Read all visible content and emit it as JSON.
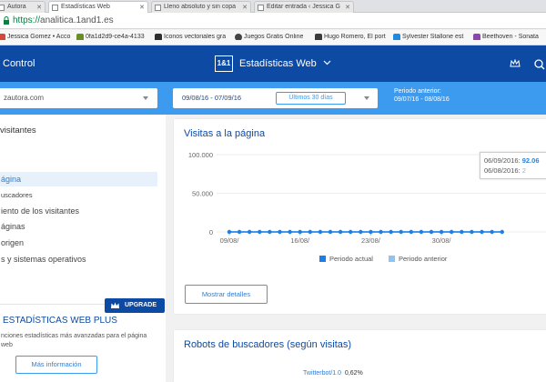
{
  "browser": {
    "tabs": [
      {
        "label": "Autora",
        "active": false
      },
      {
        "label": "Estadísticas Web",
        "active": true
      },
      {
        "label": "Lleno absoluto y sin copa",
        "active": false
      },
      {
        "label": "Editar entrada ‹ Jessica G",
        "active": false
      }
    ],
    "url_protocol": "https://",
    "url_host": "analitica.1and1.es",
    "bookmarks": [
      {
        "label": "Jessica Gomez • Acco",
        "color": "#d34836"
      },
      {
        "label": "0fa1d2d9-ce4a-4133",
        "color": "#6b8e23"
      },
      {
        "label": "Iconos vectoriales gra",
        "color": "#2f2f2f"
      },
      {
        "label": "Juegos Gratis Online",
        "color": "#444444"
      },
      {
        "label": "Hugo Romero, El port",
        "color": "#3b3b3b"
      },
      {
        "label": "Sylvester Stallone est",
        "color": "#1e88e5"
      },
      {
        "label": "Beethoven - Sonata",
        "color": "#8e44ad"
      }
    ]
  },
  "header": {
    "left_label": "Control",
    "logo_text": "1&1",
    "title": "Estadísticas Web"
  },
  "filters": {
    "domain": "zautora.com",
    "date_range": "09/08/16 - 07/09/16",
    "preset": "Últimos 30 días",
    "previous_label": "Periodo anterior:",
    "previous_range": "09/07/16 - 08/08/16"
  },
  "sidebar": {
    "heading": "visitantes",
    "items": [
      {
        "label": "ágina",
        "active": true,
        "small": false
      },
      {
        "label": "uscadores",
        "active": false,
        "small": true
      },
      {
        "label": "iento de los visitantes",
        "active": false,
        "small": false
      },
      {
        "label": "áginas",
        "active": false,
        "small": false
      },
      {
        "label": "origen",
        "active": false,
        "small": false
      },
      {
        "label": "s y sistemas operativos",
        "active": false,
        "small": false
      }
    ]
  },
  "upgrade": {
    "badge": "UPGRADE",
    "title": "ESTADÍSTICAS WEB PLUS",
    "description": "nciones estadísticas más avanzadas para el página web",
    "button": "Más información"
  },
  "visits_card": {
    "title": "Visitas a la página",
    "details_button": "Mostrar detalles",
    "tooltip": {
      "line1_date": "06/09/2016:",
      "line1_value": "92.06",
      "line2_date": "06/08/2016:",
      "line2_value": "2"
    }
  },
  "chart_data": {
    "type": "line",
    "y_ticks": [
      "100.000",
      "50.000",
      "0"
    ],
    "ylim": [
      0,
      100000
    ],
    "x_ticks": [
      "09/08/",
      "16/08/",
      "23/08/",
      "30/08/"
    ],
    "series": [
      {
        "name": "Periodo actual",
        "color": "#1a7fe8",
        "values": [
          0,
          0,
          0,
          0,
          0,
          0,
          0,
          0,
          0,
          0,
          0,
          0,
          0,
          0,
          0,
          0,
          0,
          0,
          0,
          0,
          0,
          0,
          0,
          0,
          0,
          0,
          0,
          0
        ]
      },
      {
        "name": "Periodo anterior",
        "color": "#8cc4f6",
        "values": [
          0,
          0,
          0,
          0,
          0,
          0,
          0,
          0,
          0,
          0,
          0,
          0,
          0,
          0,
          0,
          0,
          0,
          0,
          0,
          0,
          0,
          0,
          0,
          0,
          0,
          0,
          0,
          0
        ]
      }
    ],
    "grid": true,
    "legend": "bottom"
  },
  "robots_card": {
    "title": "Robots de buscadores (según visitas)",
    "rows": [
      {
        "name": "Twitterbot/1.0",
        "percent": "0,62%"
      }
    ]
  }
}
